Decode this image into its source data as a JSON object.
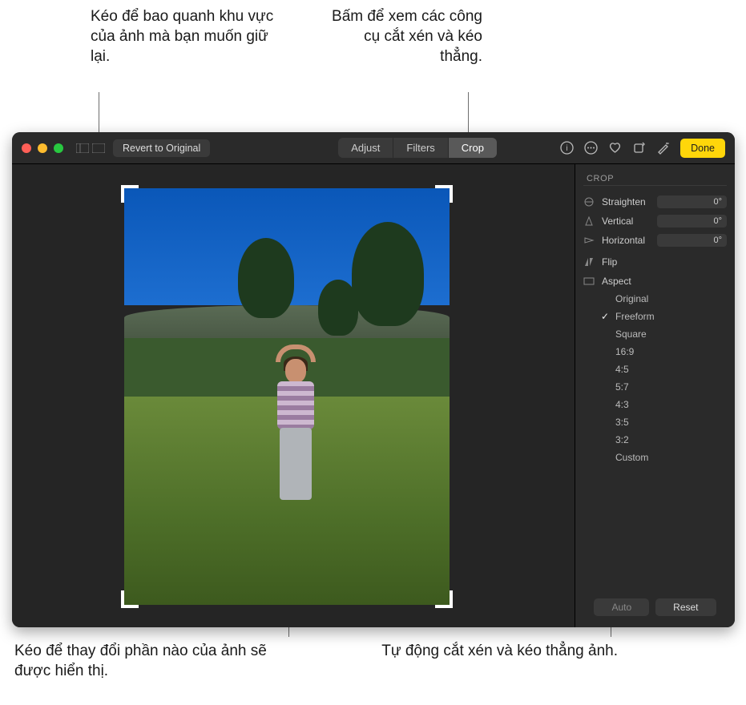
{
  "callouts": {
    "top_left": "Kéo để bao quanh khu vực của ảnh mà bạn muốn giữ lại.",
    "top_right": "Bấm để xem các công cụ cắt xén và kéo thẳng.",
    "bottom_left": "Kéo để thay đổi phần nào của ảnh sẽ được hiển thị.",
    "bottom_right": "Tự động cắt xén và kéo thẳng ảnh."
  },
  "toolbar": {
    "revert": "Revert to Original",
    "tabs": {
      "adjust": "Adjust",
      "filters": "Filters",
      "crop": "Crop"
    },
    "done": "Done"
  },
  "sidebar": {
    "title": "CROP",
    "straighten": {
      "label": "Straighten",
      "value": "0°"
    },
    "vertical": {
      "label": "Vertical",
      "value": "0°"
    },
    "horizontal": {
      "label": "Horizontal",
      "value": "0°"
    },
    "flip": "Flip",
    "aspect": "Aspect",
    "aspect_items": [
      {
        "label": "Original"
      },
      {
        "label": "Freeform",
        "selected": true
      },
      {
        "label": "Square"
      },
      {
        "label": "16:9"
      },
      {
        "label": "4:5"
      },
      {
        "label": "5:7"
      },
      {
        "label": "4:3"
      },
      {
        "label": "3:5"
      },
      {
        "label": "3:2"
      },
      {
        "label": "Custom"
      }
    ],
    "auto": "Auto",
    "reset": "Reset"
  }
}
